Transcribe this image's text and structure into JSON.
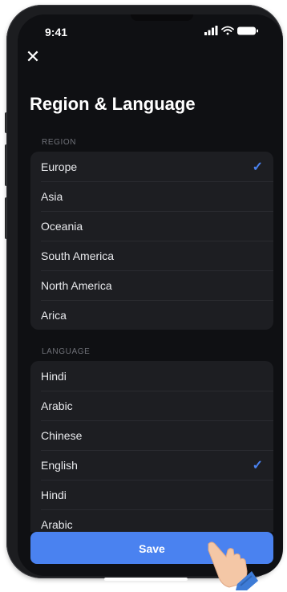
{
  "status_bar": {
    "time": "9:41"
  },
  "header": {
    "title": "Region & Language"
  },
  "region": {
    "label": "REGION",
    "items": [
      {
        "label": "Europe",
        "selected": true
      },
      {
        "label": "Asia",
        "selected": false
      },
      {
        "label": "Oceania",
        "selected": false
      },
      {
        "label": "South America",
        "selected": false
      },
      {
        "label": "North America",
        "selected": false
      },
      {
        "label": "Arica",
        "selected": false
      }
    ]
  },
  "language": {
    "label": "LANGUAGE",
    "items": [
      {
        "label": "Hindi",
        "selected": false
      },
      {
        "label": "Arabic",
        "selected": false
      },
      {
        "label": "Chinese",
        "selected": false
      },
      {
        "label": "English",
        "selected": true
      },
      {
        "label": "Hindi",
        "selected": false
      },
      {
        "label": "Arabic",
        "selected": false
      }
    ]
  },
  "actions": {
    "save_label": "Save"
  },
  "colors": {
    "accent": "#4a82f0",
    "background": "#0f1013",
    "group": "#1d1e22"
  },
  "icons": {
    "close": "close-icon",
    "check": "checkmark-icon",
    "signal": "signal-icon",
    "wifi": "wifi-icon",
    "battery": "battery-icon"
  }
}
